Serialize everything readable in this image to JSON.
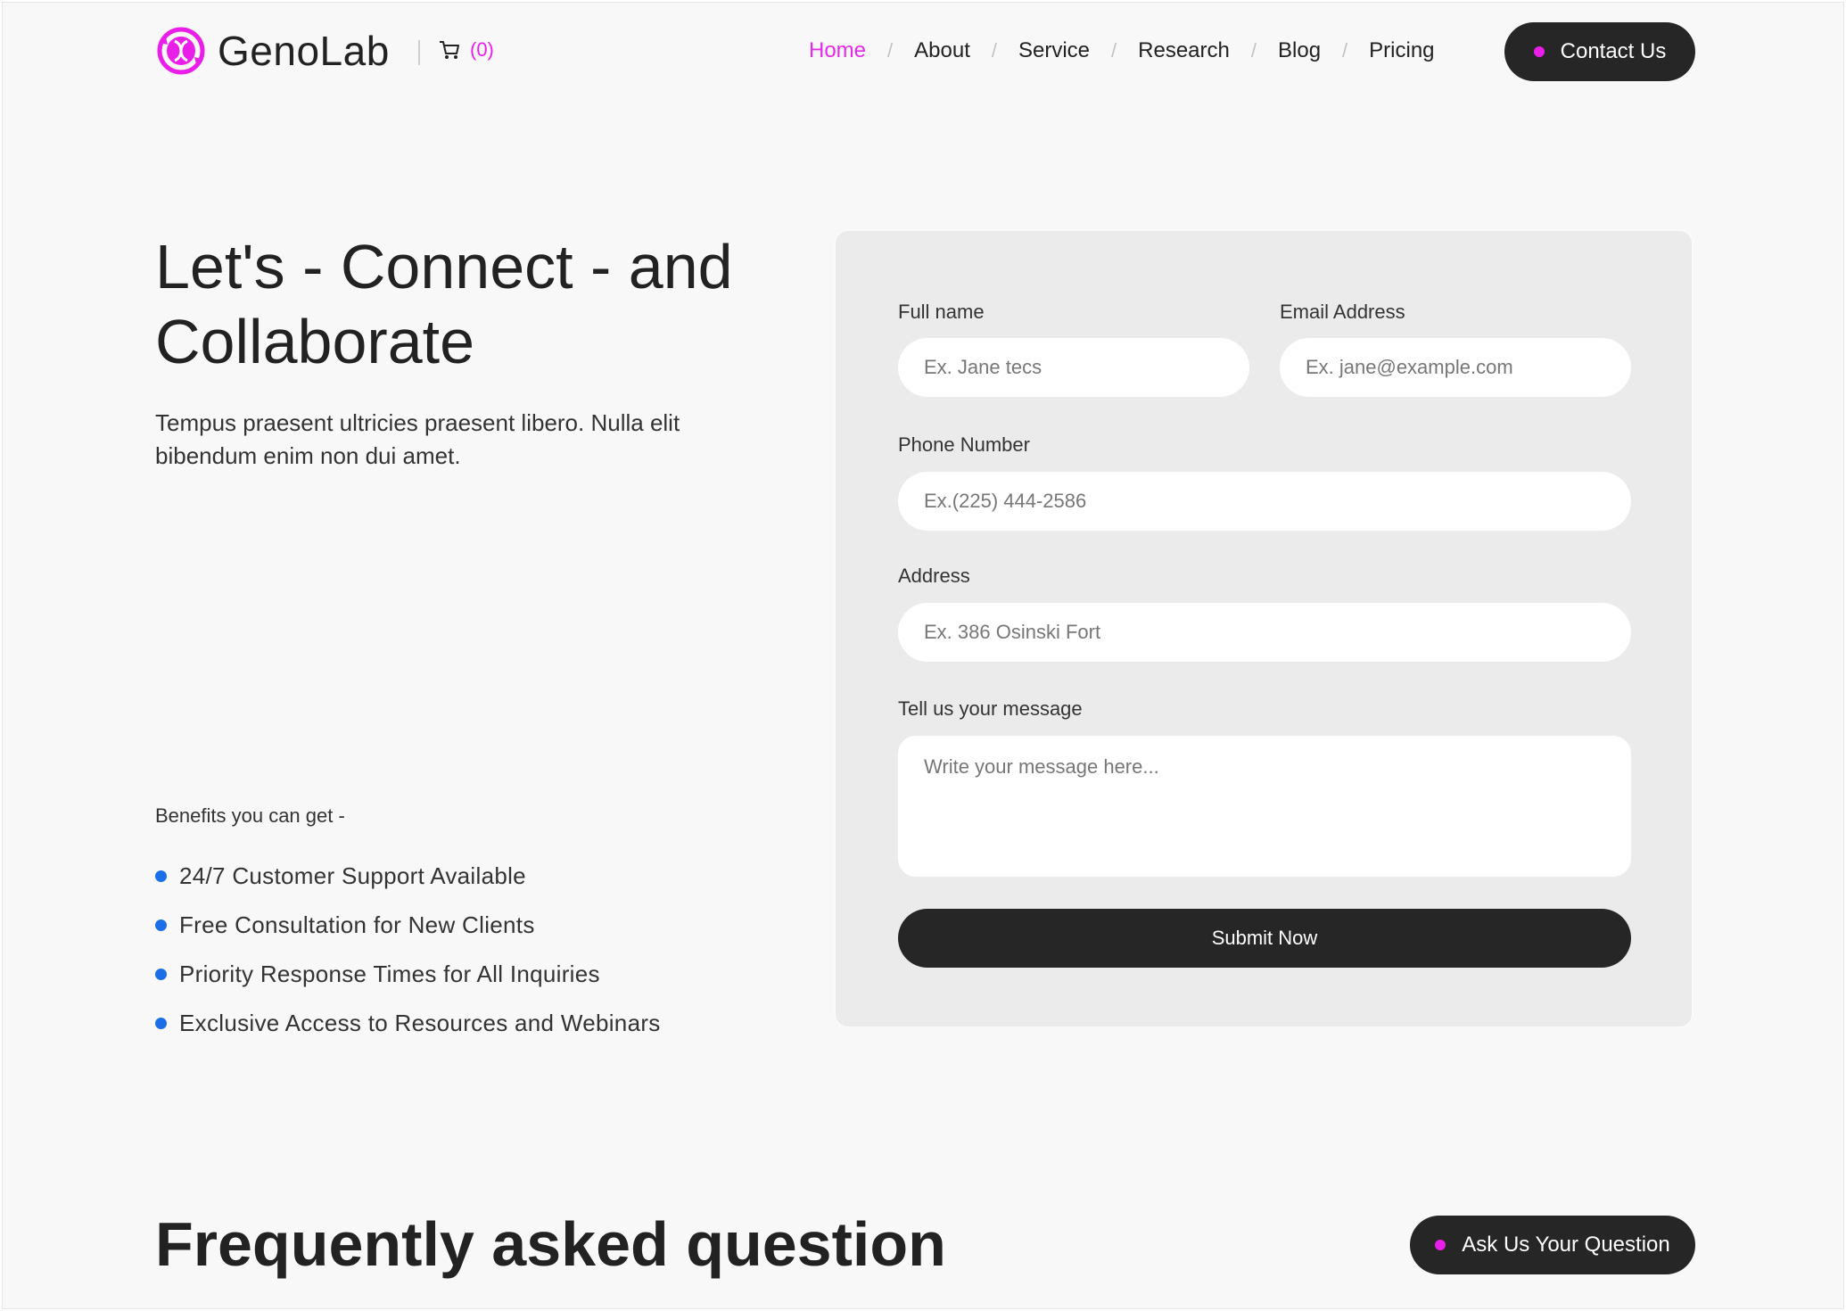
{
  "brand": {
    "name": "GenoLab",
    "accent": "#e91ee9"
  },
  "cart": {
    "icon": "cart-icon",
    "count": "(0)"
  },
  "nav": {
    "items": [
      {
        "label": "Home",
        "active": true
      },
      {
        "label": "About"
      },
      {
        "label": "Service"
      },
      {
        "label": "Research"
      },
      {
        "label": "Blog"
      },
      {
        "label": "Pricing"
      }
    ],
    "separator": "/"
  },
  "header": {
    "contact_label": "Contact Us"
  },
  "hero": {
    "title_line1": "Let's - Connect - and",
    "title_line2": "Collaborate",
    "description": "Tempus praesent ultricies praesent libero. Nulla elit bibendum enim non dui amet."
  },
  "benefits": {
    "title": "Benefits you can get -",
    "items": [
      "24/7 Customer Support Available",
      "Free Consultation for New Clients",
      "Priority Response Times for All Inquiries",
      "Exclusive Access to Resources and Webinars"
    ],
    "bullet_color": "#1a6ee8"
  },
  "form": {
    "full_name": {
      "label": "Full name",
      "placeholder": "Ex. Jane tecs"
    },
    "email": {
      "label": "Email Address",
      "placeholder": "Ex. jane@example.com"
    },
    "phone": {
      "label": "Phone Number",
      "placeholder": "Ex.(225) 444-2586"
    },
    "address": {
      "label": "Address",
      "placeholder": "Ex. 386 Osinski Fort"
    },
    "message": {
      "label": "Tell us your message",
      "placeholder": "Write your message here..."
    },
    "submit_label": "Submit Now"
  },
  "faq": {
    "title": "Frequently asked question",
    "ask_label": "Ask Us Your Question"
  }
}
